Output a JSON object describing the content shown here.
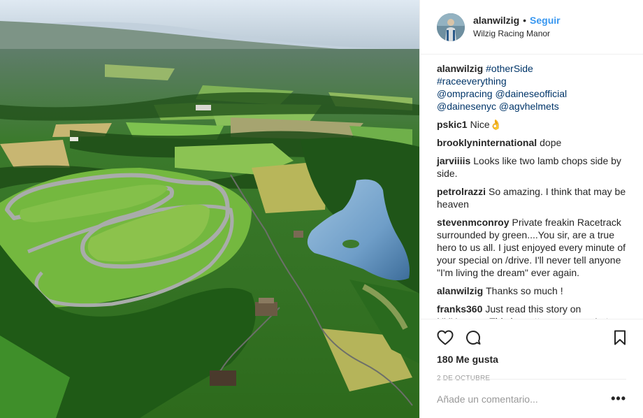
{
  "header": {
    "username": "alanwilzig",
    "separator": "•",
    "follow_label": "Seguir",
    "location": "Wilzig Racing Manor"
  },
  "caption": {
    "username": "alanwilzig",
    "lines": [
      "#otherSide",
      "#raceeverything",
      "@ompracing @daineseofficial",
      "@dainesenyc @agvhelmets"
    ]
  },
  "comments": [
    {
      "user": "pskic1",
      "text": "Nice👌"
    },
    {
      "user": "brooklyninternational",
      "text": "dope"
    },
    {
      "user": "jarviiiis",
      "text": "Looks like two lamb chops side by side."
    },
    {
      "user": "petrolrazzi",
      "text": "So amazing. I think that may be heaven"
    },
    {
      "user": "stevenmconroy",
      "text": "Private freakin Racetrack surrounded by green....You sir, are a true hero to us all. I just enjoyed every minute of your special on /drive. I'll never tell anyone \"I'm living the dream\" ever again."
    },
    {
      "user": "alanwilzig",
      "text": "Thanks so much !"
    },
    {
      "user": "franks360",
      "text": "Just read this story on NYUp.com. This is pretty awesome. Let me"
    }
  ],
  "actions": {
    "like_icon": "heart-icon",
    "comment_icon": "comment-icon",
    "save_icon": "bookmark-icon"
  },
  "likes_label": "180 Me gusta",
  "date_label": "2 DE OCTUBRE",
  "add_comment": {
    "placeholder": "Añade un comentario...",
    "more_label": "•••"
  },
  "photo": {
    "description_icon": "aerial-racetrack-photo"
  }
}
